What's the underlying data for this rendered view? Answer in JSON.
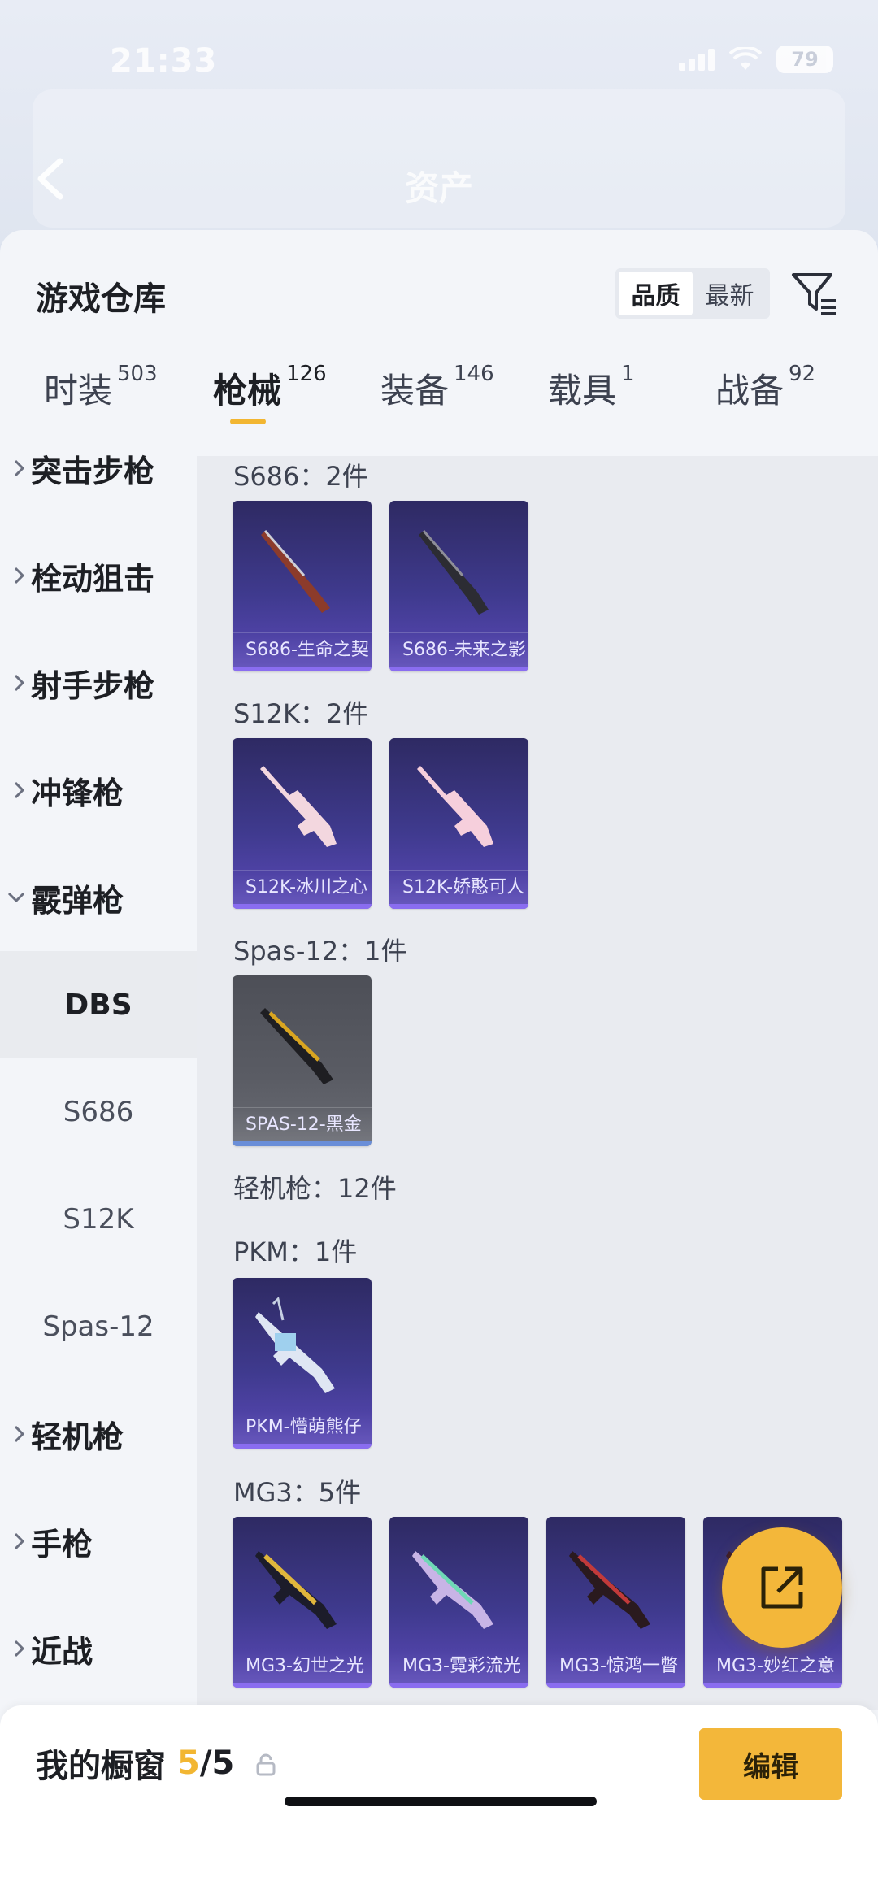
{
  "status": {
    "time": "21:33",
    "battery": "79"
  },
  "header": {
    "title": "资产"
  },
  "sheet": {
    "title": "游戏仓库"
  },
  "sort": {
    "quality": "品质",
    "newest": "最新"
  },
  "tabs": [
    {
      "label": "时装",
      "count": "503"
    },
    {
      "label": "枪械",
      "count": "126"
    },
    {
      "label": "装备",
      "count": "146"
    },
    {
      "label": "载具",
      "count": "1"
    },
    {
      "label": "战备",
      "count": "92"
    }
  ],
  "nav": {
    "items": [
      {
        "label": "突击步枪"
      },
      {
        "label": "栓动狙击"
      },
      {
        "label": "射手步枪"
      },
      {
        "label": "冲锋枪"
      },
      {
        "label": "霰弹枪"
      }
    ],
    "subs": [
      {
        "label": "DBS"
      },
      {
        "label": "S686"
      },
      {
        "label": "S12K"
      },
      {
        "label": "Spas-12"
      }
    ],
    "items_after": [
      {
        "label": "轻机枪"
      },
      {
        "label": "手枪"
      },
      {
        "label": "近战"
      }
    ]
  },
  "sections": [
    {
      "heading": "S686：2件",
      "cards": [
        "S686-生命之契",
        "S686-未来之影"
      ]
    },
    {
      "heading": "S12K：2件",
      "cards": [
        "S12K-冰川之心",
        "S12K-娇憨可人"
      ]
    },
    {
      "heading": "Spas-12：1件",
      "cards": [
        "SPAS-12-黑金"
      ]
    },
    {
      "heading": "轻机枪：12件"
    },
    {
      "heading": "PKM：1件",
      "cards": [
        "PKM-懵萌熊仔"
      ]
    },
    {
      "heading": "MG3：5件",
      "cards": [
        "MG3-幻世之光",
        "MG3-霓彩流光",
        "MG3-惊鸿一瞥",
        "MG3-妙红之意"
      ]
    }
  ],
  "bottom": {
    "label": "我的橱窗",
    "current": "5",
    "total": "/5",
    "edit": "编辑"
  },
  "colors": {
    "accent": "#f3b73a",
    "card_purple": "#3f3a8e",
    "card_grey": "#5a5c64"
  }
}
